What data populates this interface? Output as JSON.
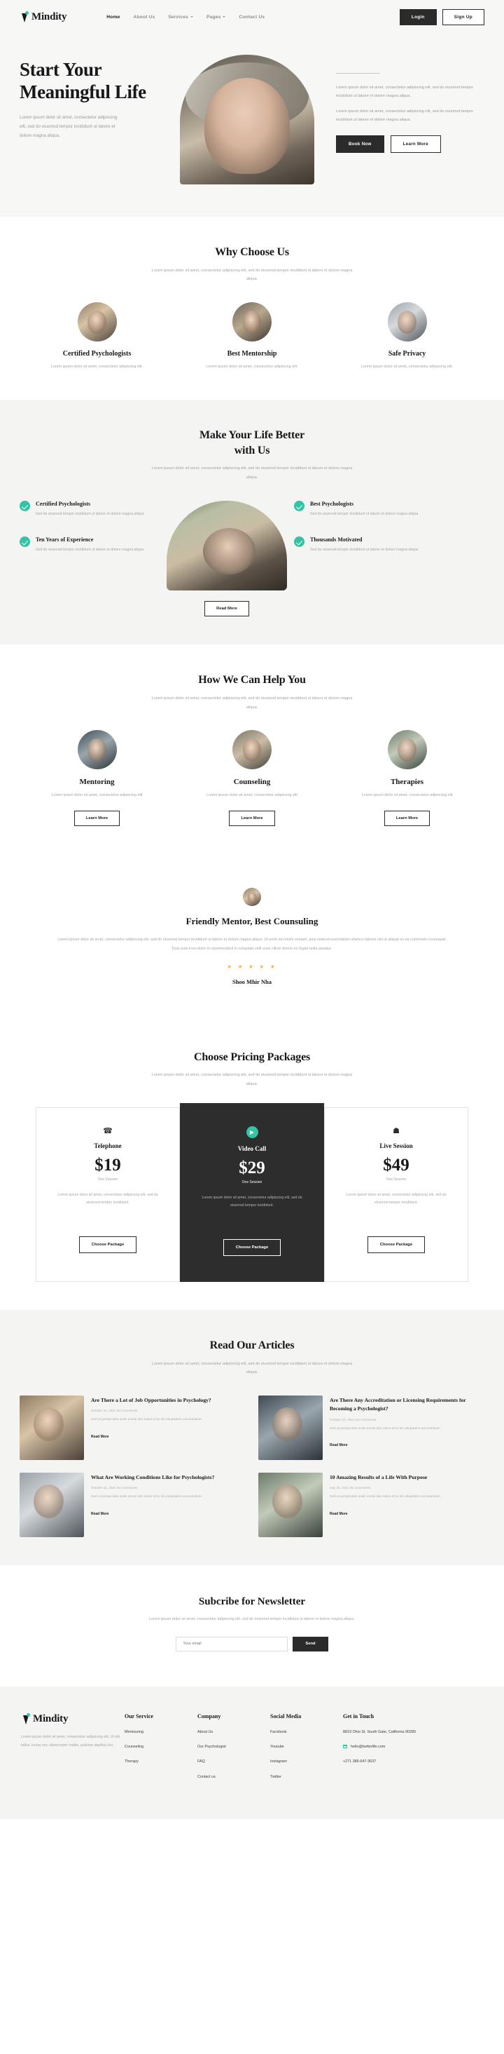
{
  "brand": {
    "name": "Mindity"
  },
  "nav": {
    "items": [
      {
        "label": "Home",
        "active": true,
        "caret": false
      },
      {
        "label": "About Us",
        "active": false,
        "caret": false
      },
      {
        "label": "Services",
        "active": false,
        "caret": true
      },
      {
        "label": "Pages",
        "active": false,
        "caret": true
      },
      {
        "label": "Contact Us",
        "active": false,
        "caret": false
      }
    ],
    "login": "Login",
    "signup": "Sign Up"
  },
  "hero": {
    "title": "Start Your Meaningful Life",
    "subtitle": "Lorem ipsum dolor sit amet, consectetur adipiscing elit, sed do eiusmod tempor incididunt ut labore et dolore magna aliqua.",
    "paragraph_1": "Lorem ipsum dolor sit amet, consectetur adipiscing elit, sed do eiusmod tempor incididunt ut labore et dolore magna aliqua.",
    "paragraph_2": "Lorem ipsum dolor sit amet, consectetur adipiscing elit, sed do eiusmod tempor incididunt ut labore et dolore magna aliqua.",
    "cta_primary": "Book Now",
    "cta_secondary": "Learn More"
  },
  "why": {
    "title": "Why Choose Us",
    "subtitle": "Lorem ipsum dolor sit amet, consectetur adipiscing elit, sed do eiusmod tempor incididunt ut labore et dolore magna aliqua.",
    "cards": [
      {
        "title": "Certified Psychologists",
        "text": "Lorem ipsum dolor sit amet, consectetur adipiscing elit."
      },
      {
        "title": "Best Mentorship",
        "text": "Lorem ipsum dolor sit amet, consectetur adipiscing elit."
      },
      {
        "title": "Safe Privacy",
        "text": "Lorem ipsum dolor sit amet, consectetur adipiscing elit."
      }
    ]
  },
  "better": {
    "title_line1": "Make Your Life Better",
    "title_line2": "with Us",
    "subtitle": "Lorem ipsum dolor sit amet, consectetur adipiscing elit, sed do eiusmod tempor incididunt ut labore et dolore magna aliqua.",
    "left": [
      {
        "title": "Certified Psychologists",
        "text": "Sed do eiusmod tempor incididunt ut labore et dolore magna aliqua"
      },
      {
        "title": "Ten Years of Experience",
        "text": "Sed do eiusmod tempor incididunt ut labore et dolore magna aliqua"
      }
    ],
    "right": [
      {
        "title": "Best Psychologists",
        "text": "Sed do eiusmod tempor incididunt ut labore et dolore magna aliqua"
      },
      {
        "title": "Thousands Motivated",
        "text": "Sed do eiusmod tempor incididunt ut labore et dolore magna aliqua"
      }
    ],
    "cta": "Read More"
  },
  "help": {
    "title": "How We Can Help You",
    "subtitle": "Lorem ipsum dolor sit amet, consectetur adipiscing elit, sed do eiusmod tempor incididunt ut labore et dolore magna aliqua.",
    "cards": [
      {
        "title": "Mentoring",
        "text": "Lorem ipsum dolor sit amet, consectetur adipiscing elit",
        "cta": "Learn More"
      },
      {
        "title": "Counseling",
        "text": "Lorem ipsum dolor sit amet, consectetur adipiscing elit",
        "cta": "Learn More"
      },
      {
        "title": "Therapies",
        "text": "Lorem ipsum dolor sit amet, consectetur adipiscing elit",
        "cta": "Learn More"
      }
    ]
  },
  "testimonial": {
    "title": "Friendly Mentor, Best Counsuling",
    "quote": "Lorem ipsum dolor sit amet, consectetur adipiscing elit, sed do eiusmod tempor incididunt ut labore et dolore magna aliqua. Ut enim ad minim veniam, quis nostrud exercitation ullamco laboris nisi ut aliquip ex ea commodo consequat. Duis aute irure dolor in reprehenderit in voluptate velit esse cillum dolore eu fugiat nulla pariatur.",
    "stars": "★ ★ ★ ★ ★",
    "author": "Shoo Mhir Nha"
  },
  "pricing": {
    "title": "Choose Pricing Packages",
    "subtitle": "Lorem ipsum dolor sit amet, consectetur adipiscing elit, sed do eiusmod tempor incididunt ut labore et dolore magna aliqua.",
    "plans": [
      {
        "icon": "☎",
        "name": "Telephone",
        "amount": "$19",
        "per": "One Session",
        "text": "Lorem ipsum dolor sit amet, consectetur adipiscing elit, sed do eiusmod tempor incididunt.",
        "cta": "Choose Package"
      },
      {
        "icon": "▶",
        "name": "Video Call",
        "amount": "$29",
        "per": "One Session",
        "text": "Lorem ipsum dolor sit amet, consectetur adipiscing elit, sed do eiusmod tempor incididunt.",
        "cta": "Choose Package"
      },
      {
        "icon": "☗",
        "name": "Live Session",
        "amount": "$49",
        "per": "One Session",
        "text": "Lorem ipsum dolor sit amet, consectetur adipiscing elit, sed do eiusmod tempor incididunt.",
        "cta": "Choose Package"
      }
    ]
  },
  "articles": {
    "title": "Read Our Articles",
    "subtitle": "Lorem ipsum dolor sit amet, consectetur adipiscing elit, sed do eiusmod tempor incididunt ut labore et dolore magna aliqua.",
    "items": [
      {
        "title": "Are There a Lot of Job Opportunities in Psychology?",
        "meta": "October 22, 2021 No Comments",
        "excerpt": "Sed ut perspiciatis unde omnis iste natus error sit voluptatem accusantium",
        "link": "Read More"
      },
      {
        "title": "Are There Any Accreditation or Licensing Requirements for Becoming a Psychologist?",
        "meta": "October 22, 2021 No Comments",
        "excerpt": "Sed ut perspiciatis unde omnis iste natus error sit voluptatem accusantium",
        "link": "Read More"
      },
      {
        "title": "What Are Working Conditions Like for Psychologists?",
        "meta": "October 22, 2021 No Comments",
        "excerpt": "Sed ut perspiciatis unde omnis iste natus error sit voluptatem accusantium",
        "link": "Read More"
      },
      {
        "title": "10 Amazing Results of a Life With Purpose",
        "meta": "July 30, 2021 No Comments",
        "excerpt": "Sed ut perspiciatis unde omnis iste natus error sit voluptatem accusantium",
        "link": "Read More"
      }
    ]
  },
  "newsletter": {
    "title": "Subcribe for Newsletter",
    "subtitle": "Lorem ipsum dolor sit amet, consectetur adipiscing elit, sed do eiusmod tempor incididunt ut labore et dolore magna aliqua.",
    "placeholder": "Your email",
    "button": "Send"
  },
  "footer": {
    "brand": "Mindity",
    "about": "Lorem ipsum dolor sit amet, consectetur adipiscing elit. Ut elit tellus, luctus nec ullamcorper mattis, pulvinar dapibus leo.",
    "columns": [
      {
        "title": "Our Service",
        "links": [
          "Mentouring",
          "Counseling",
          "Therapy"
        ]
      },
      {
        "title": "Company",
        "links": [
          "About Us",
          "Our Psychologist",
          "FAQ",
          "Contact us"
        ]
      },
      {
        "title": "Social Media",
        "links": [
          "Facebook",
          "Youtube",
          "Instagram",
          "Twitter"
        ]
      }
    ],
    "contact": {
      "title": "Get in Touch",
      "address": "8819 Ohio St. South Gate, California 90280",
      "email": "hello@betterlife.com",
      "phone": "+271 386-647-3637"
    }
  },
  "colors": {
    "accent": "#35c2a5",
    "dark": "#2b2b2b",
    "star": "#f5b833"
  }
}
